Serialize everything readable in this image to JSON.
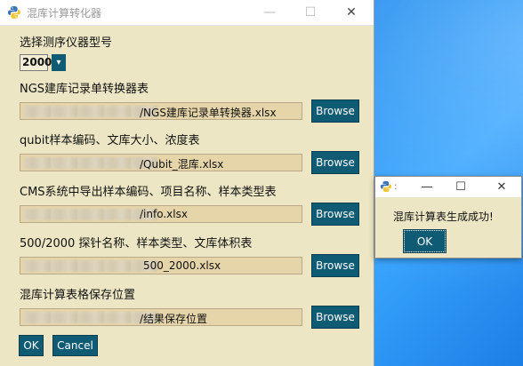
{
  "window": {
    "title": "混库计算转化器",
    "minimize": "—",
    "maximize": "☐",
    "close": "✕"
  },
  "instrument": {
    "label": "选择测序仪器型号",
    "value": "2000",
    "arrow": "▾"
  },
  "rows": [
    {
      "label": "NGS建库记录单转换器表",
      "value": "/NGS建库记录单转换器.xlsx",
      "button": "Browse"
    },
    {
      "label": "qubit样本编码、文库大小、浓度表",
      "value": "/Qubit_混库.xlsx",
      "button": "Browse"
    },
    {
      "label": "CMS系统中导出样本编码、项目名称、样本类型表",
      "value": "/info.xlsx",
      "button": "Browse"
    },
    {
      "label": "500/2000 探针名称、样本类型、文库体积表",
      "value": "500_2000.xlsx",
      "button": "Browse"
    },
    {
      "label": "混库计算表格保存位置",
      "value": "/结果保存位置",
      "button": "Browse"
    }
  ],
  "actions": {
    "ok": "OK",
    "cancel": "Cancel"
  },
  "dialog": {
    "title": ":",
    "minimize": "—",
    "maximize": "☐",
    "close": "✕",
    "message": "混库计算表生成成功!",
    "ok": "OK"
  }
}
